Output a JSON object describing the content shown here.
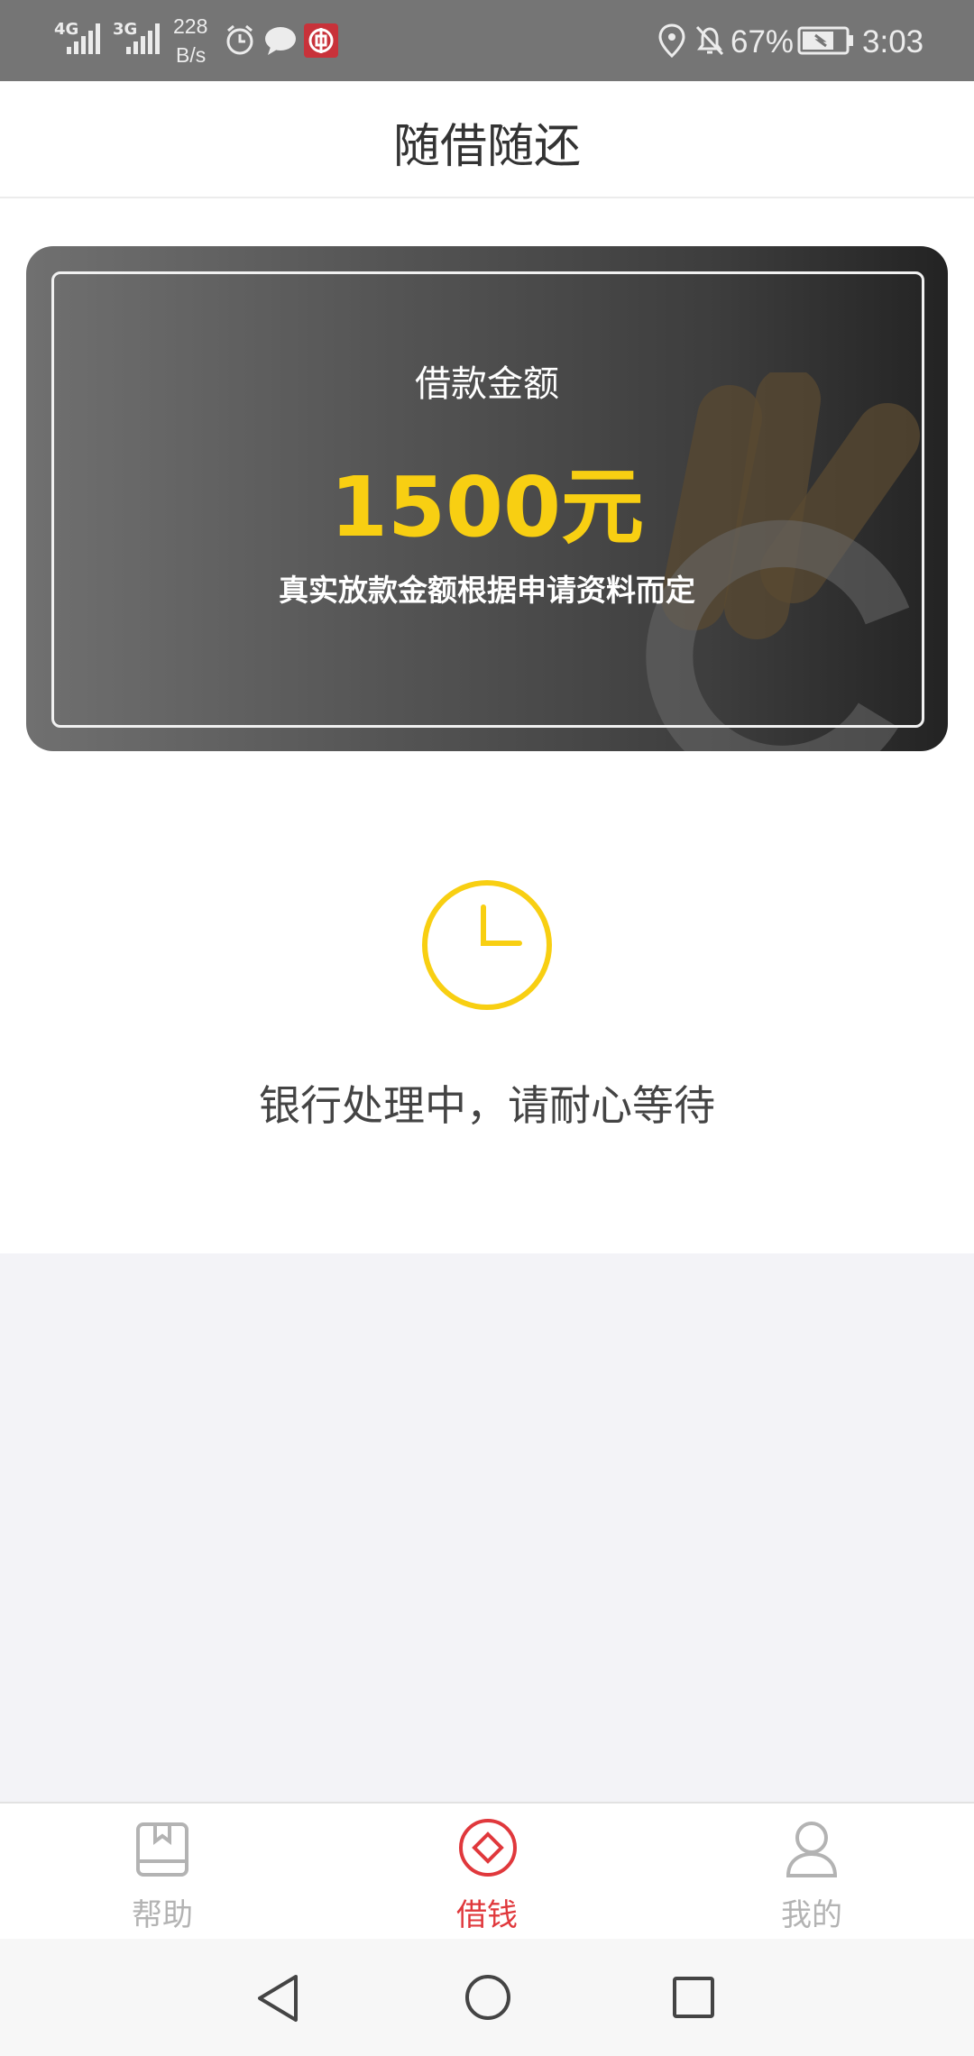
{
  "status_bar": {
    "net1": "4G",
    "net2": "3G",
    "speed_value": "228",
    "speed_unit": "B/s",
    "battery": "67%",
    "time": "3:03"
  },
  "header": {
    "title": "随借随还"
  },
  "card": {
    "label": "借款金额",
    "amount": "1500元",
    "note": "真实放款金额根据申请资料而定"
  },
  "status": {
    "icon": "clock-icon",
    "text": "银行处理中，请耐心等待"
  },
  "bottom_nav": {
    "items": [
      {
        "label": "帮助",
        "icon": "help-book-icon",
        "active": false
      },
      {
        "label": "借钱",
        "icon": "borrow-diamond-icon",
        "active": true
      },
      {
        "label": "我的",
        "icon": "user-icon",
        "active": false
      }
    ]
  },
  "colors": {
    "accent": "#e0383c",
    "amount": "#f8cf12",
    "clock": "#f8cf12"
  }
}
